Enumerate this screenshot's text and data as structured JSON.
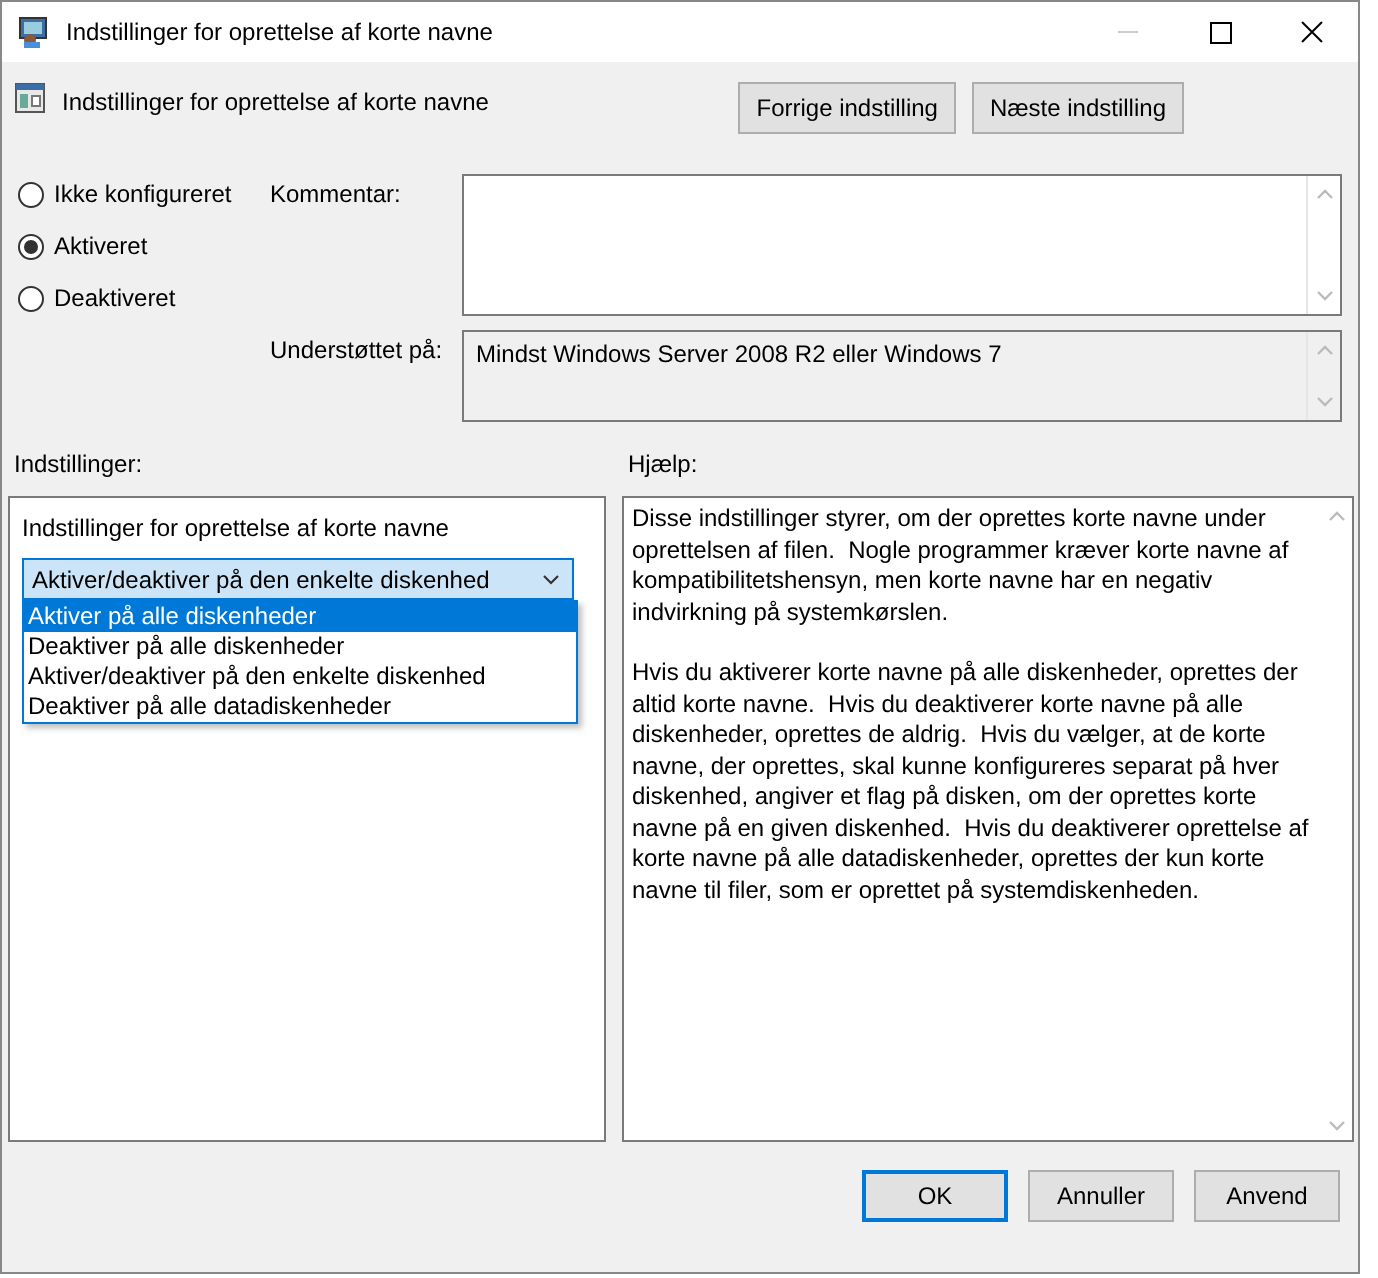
{
  "window": {
    "title": "Indstillinger for oprettelse af korte navne"
  },
  "header": {
    "title": "Indstillinger for oprettelse af korte navne",
    "buttons": [
      "Forrige indstilling",
      "Næste indstilling"
    ]
  },
  "state_options": [
    {
      "label": "Ikke konfigureret",
      "selected": false
    },
    {
      "label": "Aktiveret",
      "selected": true
    },
    {
      "label": "Deaktiveret",
      "selected": false
    }
  ],
  "comment": {
    "label": "Kommentar:"
  },
  "supported": {
    "label": "Understøttet på:",
    "value": "Mindst Windows Server 2008 R2 eller Windows 7"
  },
  "options_panel": {
    "label": "Indstillinger:",
    "setting_label": "Indstillinger for oprettelse af korte navne",
    "dropdown": {
      "value": "Aktiver/deaktiver på den enkelte diskenhed",
      "expanded": true,
      "options": [
        {
          "label": "Aktiver på alle diskenheder",
          "highlighted": true
        },
        {
          "label": "Deaktiver på alle diskenheder",
          "highlighted": false
        },
        {
          "label": "Aktiver/deaktiver på den enkelte diskenhed",
          "highlighted": false
        },
        {
          "label": "Deaktiver på alle datadiskenheder",
          "highlighted": false
        }
      ]
    }
  },
  "help_panel": {
    "label": "Hjælp:",
    "paragraphs": [
      "Disse indstillinger styrer, om der oprettes korte navne under oprettelsen af filen.  Nogle programmer kræver korte navne af kompatibilitetshensyn, men korte navne har en negativ indvirkning på systemkørslen.",
      "Hvis du aktiverer korte navne på alle diskenheder, oprettes der altid korte navne.  Hvis du deaktiverer korte navne på alle diskenheder, oprettes de aldrig.  Hvis du vælger, at de korte navne, der oprettes, skal kunne konfigureres separat på hver diskenhed, angiver et flag på disken, om der oprettes korte navne på en given diskenhed.  Hvis du deaktiverer oprettelse af korte navne på alle datadiskenheder, oprettes der kun korte navne til filer, som er oprettet på systemdiskenheden."
    ]
  },
  "footer_buttons": [
    {
      "label": "OK",
      "default": true
    },
    {
      "label": "Annuller",
      "default": false
    },
    {
      "label": "Anvend",
      "default": false
    }
  ]
}
